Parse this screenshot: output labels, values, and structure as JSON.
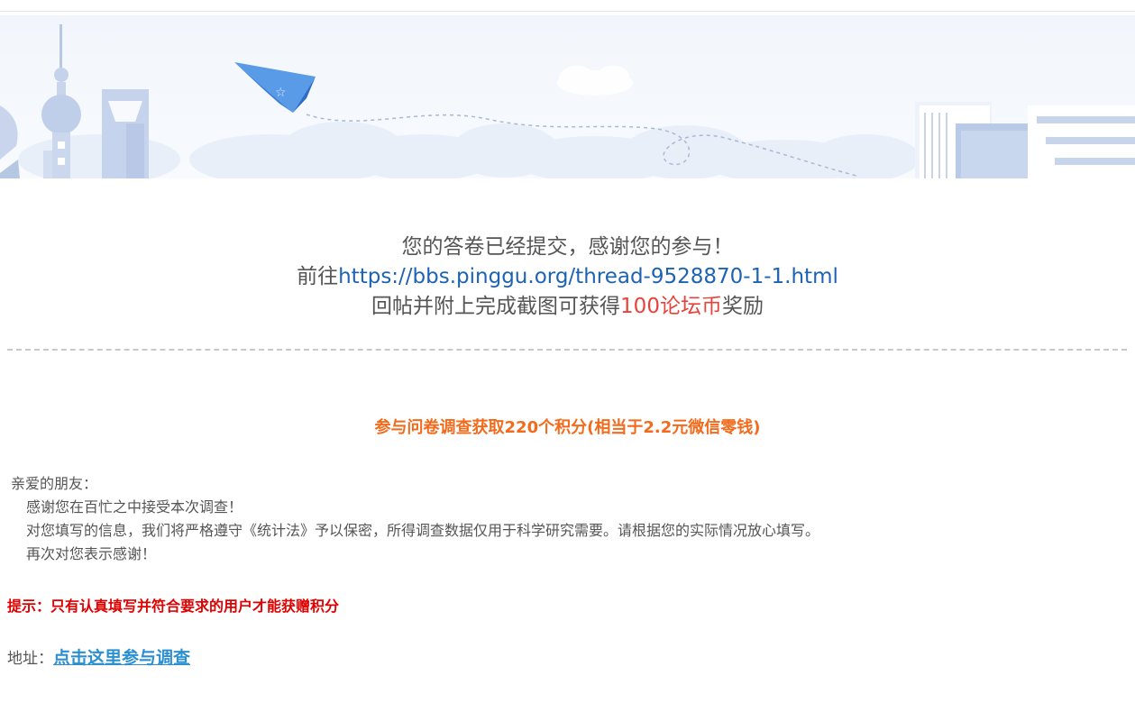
{
  "confirmation": {
    "line1": "您的答卷已经提交，感谢您的参与！",
    "line2_prefix": "前往",
    "line2_link": "https://bbs.pinggu.org/thread-9528870-1-1.html",
    "line3_prefix": "回帖并附上完成截图可获得",
    "line3_reward": "100论坛币",
    "line3_suffix": "奖励"
  },
  "survey": {
    "title": "参与问卷调查获取220个积分(相当于2.2元微信零钱)",
    "greeting": "亲爱的朋友：",
    "paragraphs": [
      "感谢您在百忙之中接受本次调查！",
      "对您填写的信息，我们将严格遵守《统计法》予以保密，所得调查数据仅用于科学研究需要。请根据您的实际情况放心填写。",
      "再次对您表示感谢！"
    ],
    "tip": "提示：只有认真填写并符合要求的用户才能获赠积分",
    "address_label": "地址：",
    "address_link": "点击这里参与调查"
  },
  "colors": {
    "link": "#1d63b3",
    "reward_red": "#e8433b",
    "survey_title_orange": "#f26b1d",
    "tip_red": "#e00000",
    "survey_link": "#2b8fd0"
  },
  "icons": [
    "paper-plane-icon",
    "tv-tower-icon",
    "skyscraper-icon",
    "books-icon",
    "cloud-icon"
  ]
}
